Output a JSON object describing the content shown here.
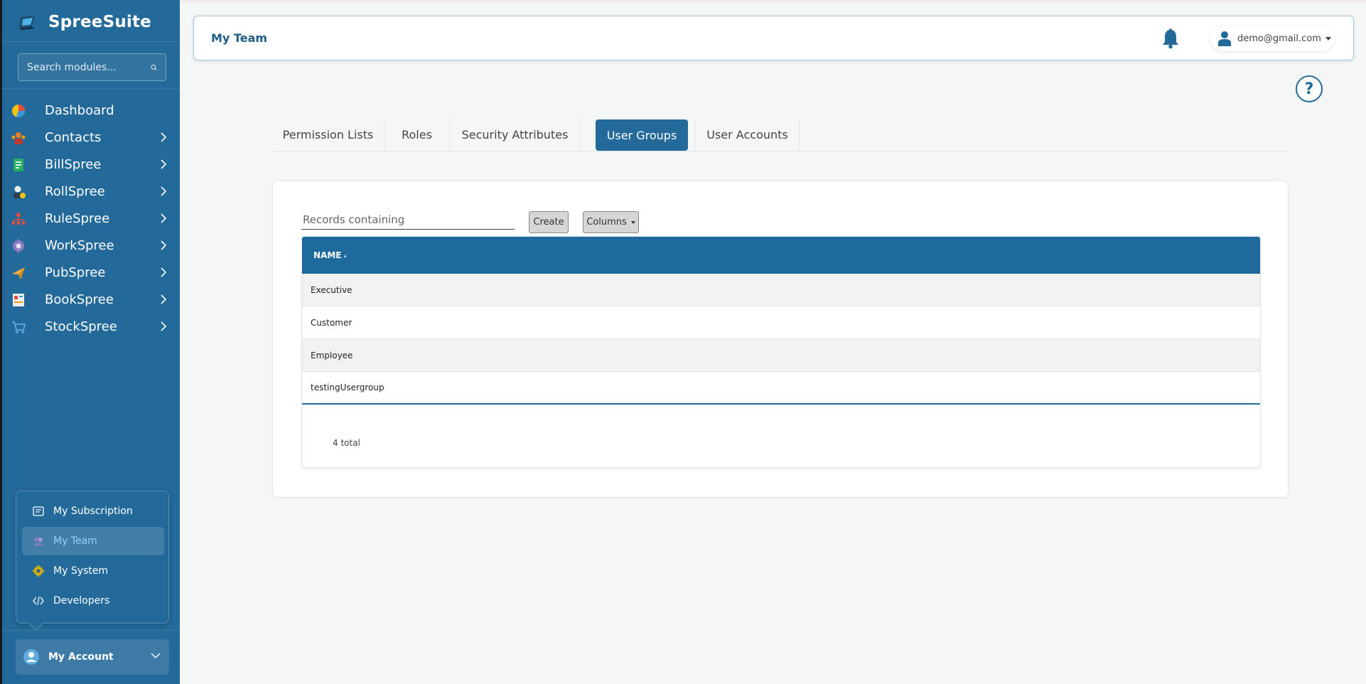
{
  "app": {
    "name": "SpreeSuite"
  },
  "search": {
    "placeholder": "Search modules..."
  },
  "nav": {
    "items": [
      {
        "label": "Dashboard",
        "icon": "dashboard-icon",
        "has_children": false
      },
      {
        "label": "Contacts",
        "icon": "contacts-icon",
        "has_children": true
      },
      {
        "label": "BillSpree",
        "icon": "billspree-icon",
        "has_children": true
      },
      {
        "label": "RollSpree",
        "icon": "rollspree-icon",
        "has_children": true
      },
      {
        "label": "RuleSpree",
        "icon": "rulespree-icon",
        "has_children": true
      },
      {
        "label": "WorkSpree",
        "icon": "workspree-icon",
        "has_children": true
      },
      {
        "label": "PubSpree",
        "icon": "pubspree-icon",
        "has_children": true
      },
      {
        "label": "BookSpree",
        "icon": "bookspree-icon",
        "has_children": true
      },
      {
        "label": "StockSpree",
        "icon": "stockspree-icon",
        "has_children": true
      }
    ]
  },
  "account_menu": {
    "items": [
      {
        "label": "My Subscription",
        "icon": "subscription-icon",
        "active": false
      },
      {
        "label": "My Team",
        "icon": "team-icon",
        "active": true
      },
      {
        "label": "My System",
        "icon": "system-gear-icon",
        "active": false
      },
      {
        "label": "Developers",
        "icon": "code-icon",
        "active": false
      }
    ],
    "toggle_label": "My Account"
  },
  "header": {
    "title": "My Team",
    "user_email": "demo@gmail.com"
  },
  "help": {
    "label": "?"
  },
  "tabs": [
    {
      "label": "Permission Lists",
      "active": false
    },
    {
      "label": "Roles",
      "active": false
    },
    {
      "label": "Security Attributes",
      "active": false
    },
    {
      "label": "User Groups",
      "active": true
    },
    {
      "label": "User Accounts",
      "active": false
    }
  ],
  "toolbar": {
    "records_placeholder": "Records containing",
    "create_label": "Create",
    "columns_label": "Columns"
  },
  "table": {
    "columns": [
      "NAME"
    ],
    "rows": [
      "Executive",
      "Customer",
      "Employee",
      "testingUsergroup"
    ],
    "total_label": "4 total"
  },
  "colors": {
    "sidebar": "#23699a",
    "accent": "#23699a",
    "table_header": "#1f6a9c"
  }
}
